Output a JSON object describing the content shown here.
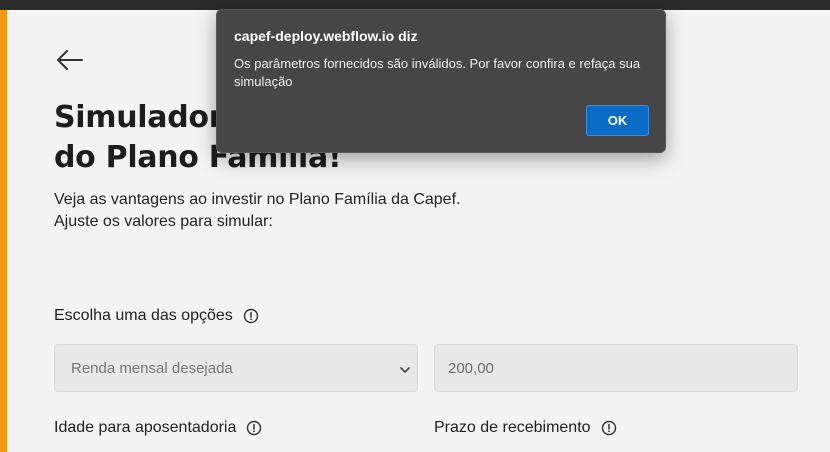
{
  "page": {
    "title_line1": "Simulador",
    "title_line2": "do Plano Família!",
    "intro_line1": "Veja as vantagens ao investir no Plano Família da Capef.",
    "intro_line2": "Ajuste os valores para simular:",
    "accent_color": "#f29a13"
  },
  "form": {
    "option_label": "Escolha uma das opções",
    "option_selected": "Renda mensal desejada",
    "value_field": "200,00",
    "age_label": "Idade para aposentadoria",
    "term_label": "Prazo de recebimento"
  },
  "icons": {
    "back": "arrow-left-icon",
    "info": "info-circle-icon",
    "dropdown": "chevron-down-icon"
  },
  "dialog": {
    "title": "capef-deploy.webflow.io diz",
    "message_line1": "Os parâmetros fornecidos são inválidos. Por favor confira e refaça sua",
    "message_line2": "simulação",
    "ok_label": "OK",
    "button_color": "#0a6cc7"
  }
}
